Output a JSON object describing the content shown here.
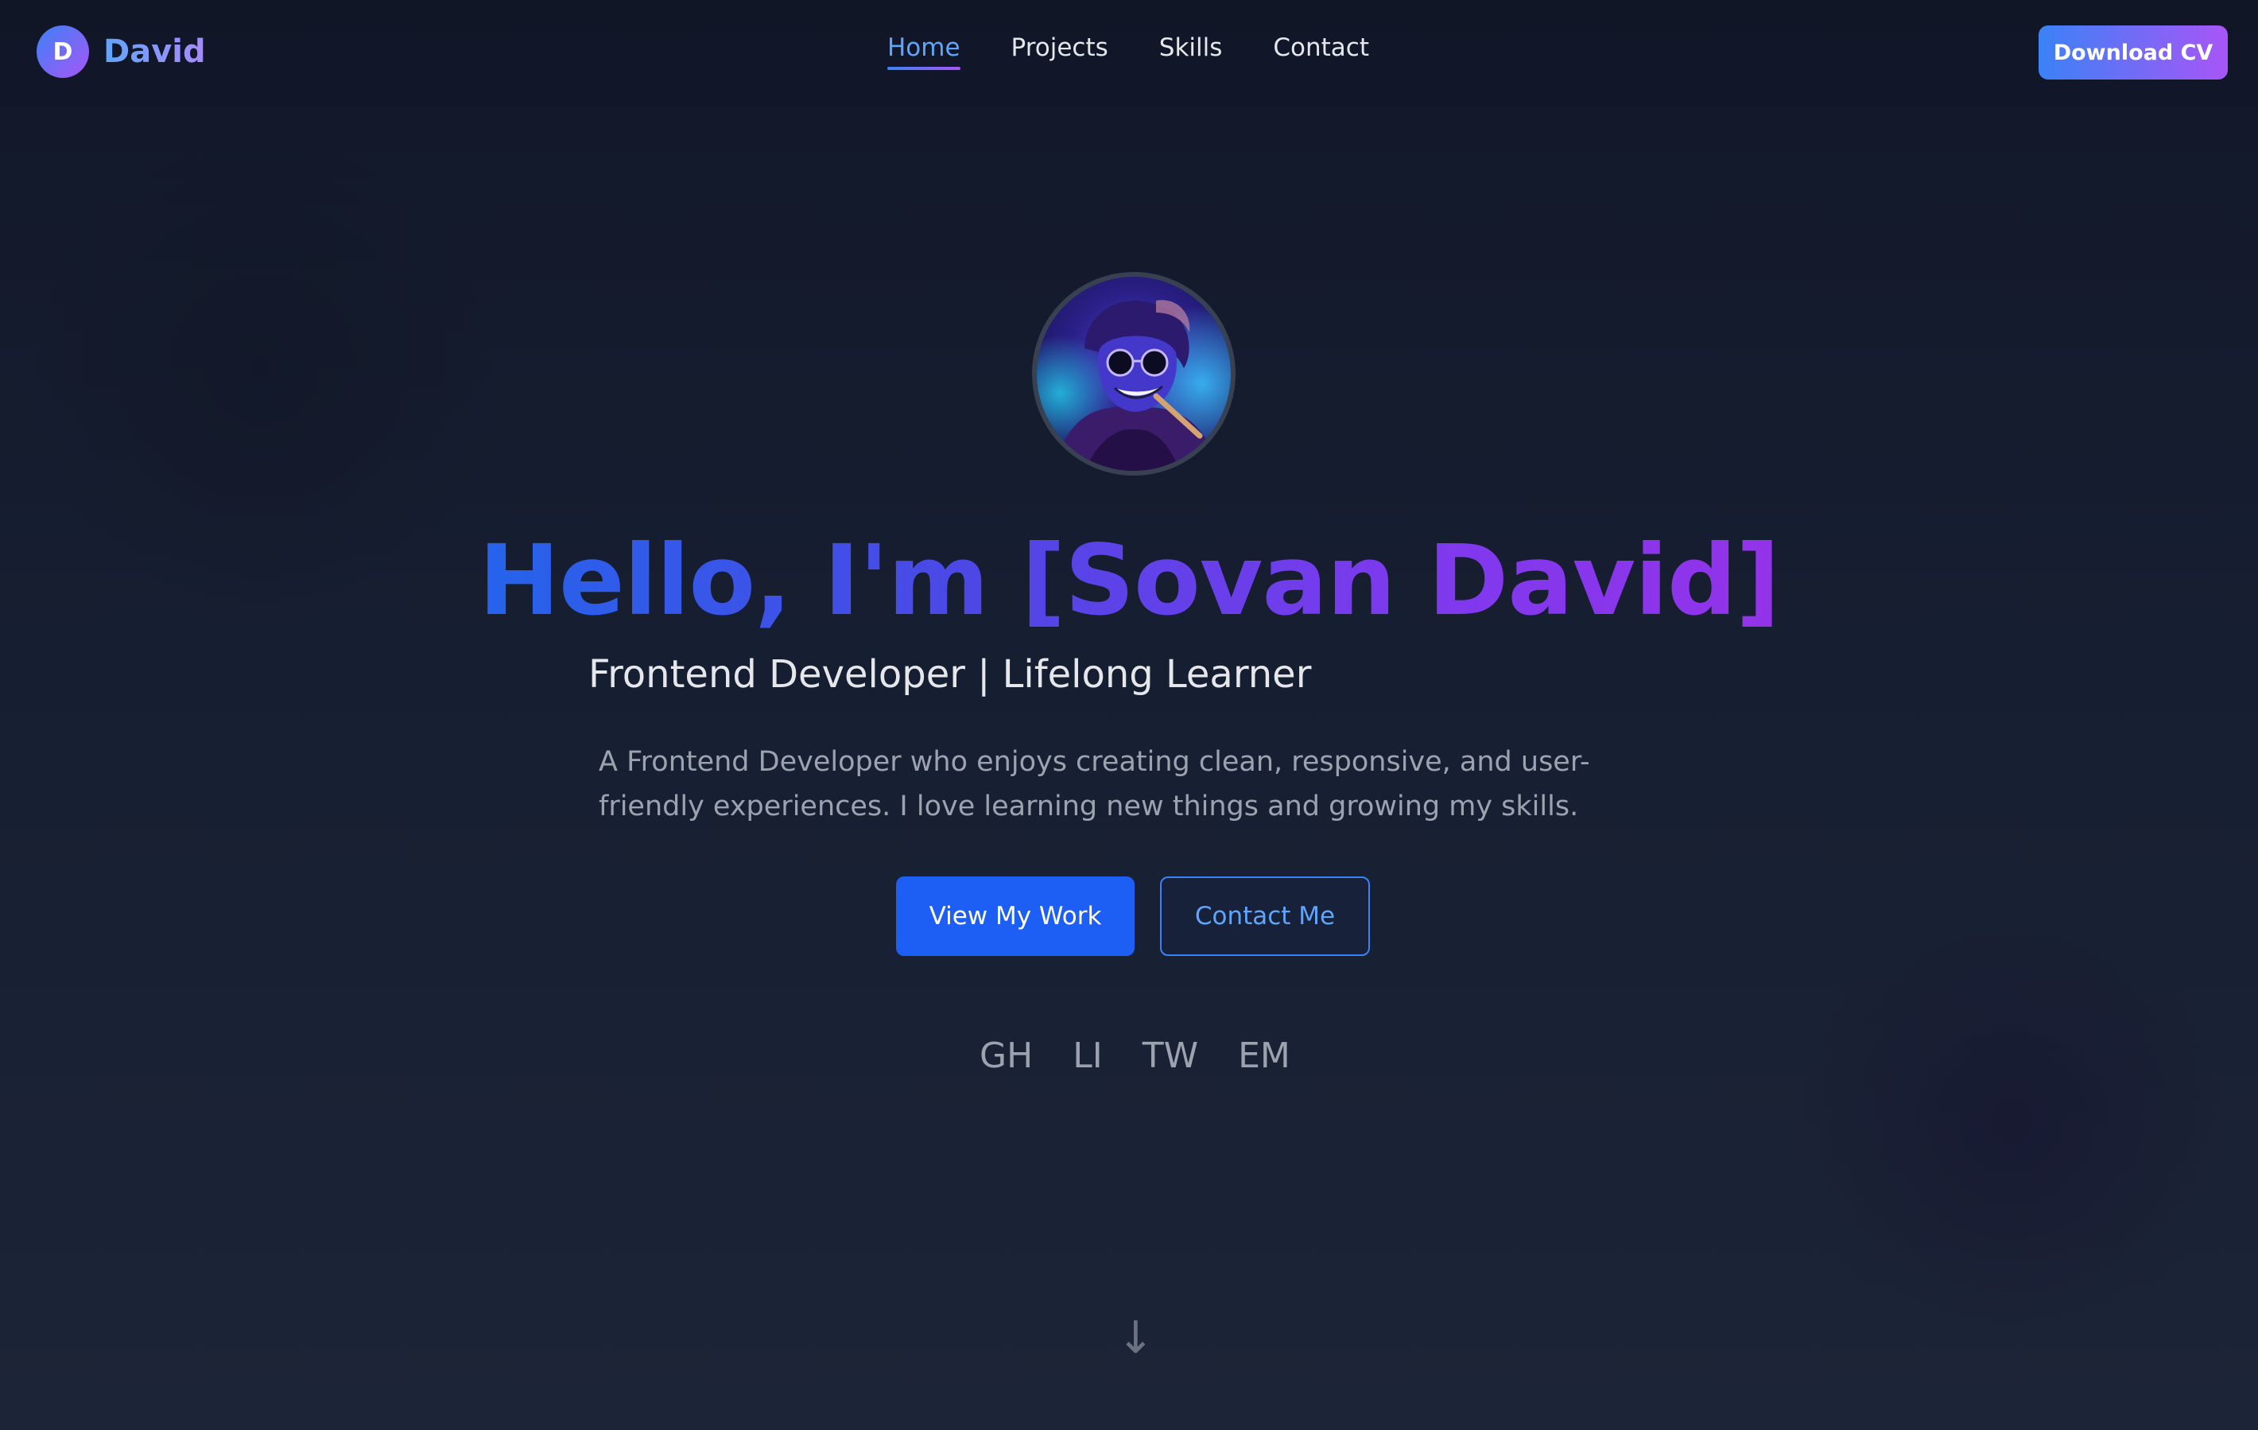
{
  "header": {
    "logo_letter": "D",
    "brand_name": "David",
    "nav": [
      {
        "label": "Home",
        "active": true
      },
      {
        "label": "Projects",
        "active": false
      },
      {
        "label": "Skills",
        "active": false
      },
      {
        "label": "Contact",
        "active": false
      }
    ],
    "cta_label": "Download CV"
  },
  "hero": {
    "avatar_icon": "profile-avatar",
    "title": "Hello, I'm [Sovan David]",
    "subtitle": "Frontend Developer | Lifelong Learner",
    "description": "A Frontend Developer who enjoys creating clean, responsive, and user-friendly experiences. I love learning new things and growing my skills.",
    "primary_button": "View My Work",
    "secondary_button": "Contact Me",
    "socials": [
      "GH",
      "LI",
      "TW",
      "EM"
    ],
    "scroll_indicator": "↓"
  },
  "colors": {
    "accent_blue": "#3b82f6",
    "accent_purple": "#a855f7",
    "primary_button": "#1d5ff5",
    "background": "#161e31"
  }
}
